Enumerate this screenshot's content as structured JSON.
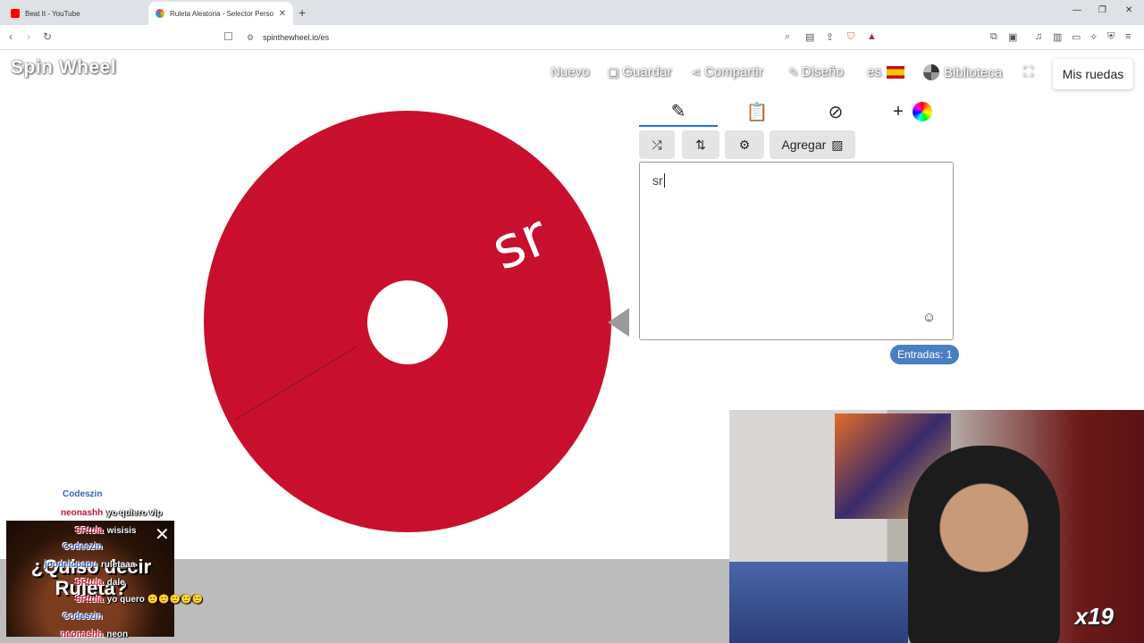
{
  "browser": {
    "tabs": [
      {
        "title": "Beat It - YouTube",
        "favicon_color": "#ff0000"
      },
      {
        "title": "Ruleta Aleatoria - Selector Perso",
        "favicon_color": "#34a853"
      }
    ],
    "url": "spinthewheel.io/es"
  },
  "app": {
    "logo": "Spin Wheel",
    "menu": {
      "nuevo": "Nuevo",
      "guardar": "Guardar",
      "compartir": "Compartir",
      "diseno": "Diseño",
      "lang": "es",
      "biblioteca": "Biblioteca"
    },
    "mis_ruedas": "Mis ruedas",
    "wheel": {
      "color": "#c8102e",
      "entries": [
        "sr"
      ]
    },
    "editor": {
      "add_label": "Agregar",
      "text": "sr",
      "entradas": "Entradas: 1"
    }
  },
  "overlay": {
    "clip_title": "¿Quiso decir Ruleta?",
    "multiplier": "x19",
    "chat": [
      {
        "user": "Codeszin",
        "color": "blue",
        "text": ""
      },
      {
        "user": "neonashh",
        "color": "red",
        "text": "yo quiero vip"
      },
      {
        "user": "SRtula",
        "color": "red",
        "text": "wisisis"
      },
      {
        "user": "Codeszin",
        "color": "blue",
        "text": ""
      },
      {
        "user": "joodelcpapu",
        "color": "blue",
        "text": "ruletaaa"
      },
      {
        "user": "SRtula",
        "color": "red",
        "text": "dale"
      },
      {
        "user": "SRtula",
        "color": "red",
        "text": "yo quero 🙂🙂🙂🙂🙂"
      },
      {
        "user": "Codeszin",
        "color": "blue",
        "text": ""
      },
      {
        "user": "neonashh",
        "color": "red",
        "text": "neon"
      }
    ]
  }
}
